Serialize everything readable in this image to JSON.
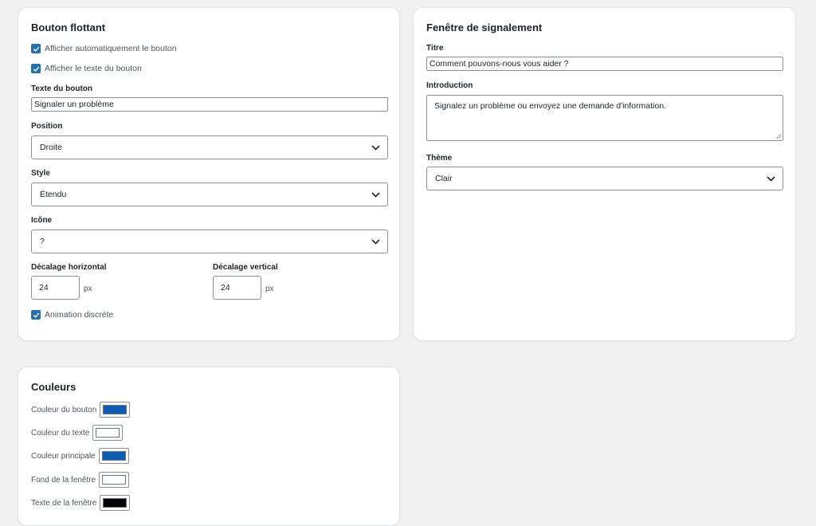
{
  "floating_button": {
    "title": "Bouton flottant",
    "auto_show_label": "Afficher automatiquement le bouton",
    "show_text_label": "Afficher le texte du bouton",
    "button_text_label": "Texte du bouton",
    "button_text_value": "Signaler un problème",
    "position_label": "Position",
    "position_value": "Droite",
    "style_label": "Style",
    "style_value": "Étendu",
    "icon_label": "Icône",
    "icon_value": "?",
    "offset_h_label": "Décalage horizontal",
    "offset_h_value": "24",
    "offset_v_label": "Décalage vertical",
    "offset_v_value": "24",
    "unit": "px",
    "animation_label": "Animation discrète"
  },
  "report_window": {
    "title": "Fenêtre de signalement",
    "title_label": "Titre",
    "title_value": "Comment pouvons-nous vous aider ?",
    "intro_label": "Introduction",
    "intro_value": "Signalez un problème ou envoyez une demande d'information.",
    "theme_label": "Thème",
    "theme_value": "Clair"
  },
  "colors": {
    "title": "Couleurs",
    "items": [
      {
        "label": "Couleur du bouton",
        "color": "#0a5db2"
      },
      {
        "label": "Couleur du texte",
        "color": "#ffffff"
      },
      {
        "label": "Couleur principale",
        "color": "#0a5db2"
      },
      {
        "label": "Fond de la fenêtre",
        "color": "#ffffff"
      },
      {
        "label": "Texte de la fenêtre",
        "color": "#000000"
      }
    ]
  },
  "theme": {
    "checkbox_color": "#2271b1"
  }
}
